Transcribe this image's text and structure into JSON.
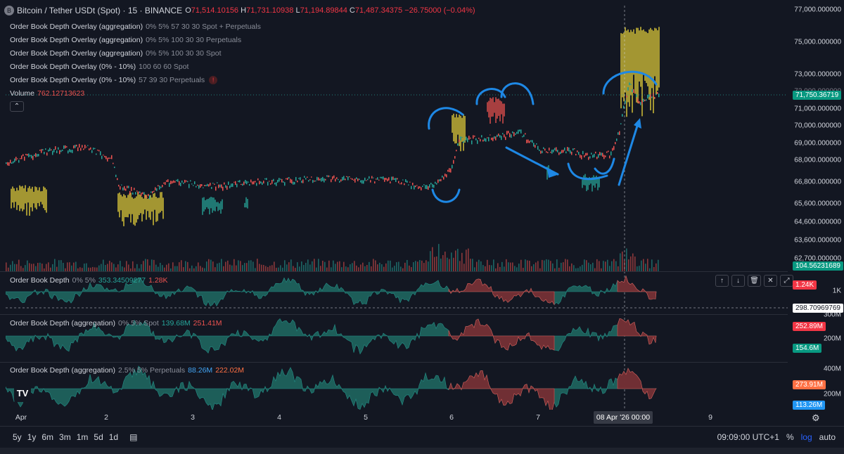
{
  "header": {
    "symbol_icon": "B",
    "symbol": "Bitcoin / Tether USDt (Spot) · 15 · BINANCE",
    "o_label": "O",
    "o": "71,514.10156",
    "h_label": "H",
    "h": "71,731.10938",
    "l_label": "L",
    "l": "71,194.89844",
    "c_label": "C",
    "c": "71,487.34375",
    "change": "−26.75000 (−0.04%)"
  },
  "legend": [
    {
      "name": "Order Book Depth Overlay (aggregation)",
      "params": "0% 5% 57 30 30 Spot + Perpetuals"
    },
    {
      "name": "Order Book Depth Overlay (aggregation)",
      "params": "0% 5% 100 30 30 Perpetuals"
    },
    {
      "name": "Order Book Depth Overlay (aggregation)",
      "params": "0% 5% 100 30 30 Spot"
    },
    {
      "name": "Order Book Depth Overlay (0% - 10%)",
      "params": "100 60 60 Spot"
    },
    {
      "name": "Order Book Depth Overlay (0% - 10%)",
      "params": "57 39 30 Perpetuals"
    }
  ],
  "volume": {
    "name": "Volume",
    "value": "762.12713623"
  },
  "price_axis": [
    "77,000.000000",
    "75,000.000000",
    "73,000.000000",
    "71,000.000000",
    "70,000.000000",
    "69,000.000000",
    "68,000.000000",
    "66,800.000000",
    "65,600.000000",
    "64,600.000000",
    "63,600.000000",
    "62,700.000000"
  ],
  "price_tags": {
    "last": "71,750.36719",
    "volume": "104.56231689",
    "obd1_red": "1.24K",
    "obd1_cross": "298.70969769",
    "obd2_red": "252.89M",
    "obd2_green": "154.6M",
    "obd3_red": "273.91M",
    "obd3_blue": "113.26M"
  },
  "price_partial": "72,000.000000",
  "pane1": {
    "name": "Order Book Depth",
    "params": "0% 5%",
    "v1": "353.34509277",
    "v2": "1.28K",
    "axis": [
      "1K",
      "300M"
    ]
  },
  "pane2": {
    "name": "Order Book Depth (aggregation)",
    "params": "0% 5% Spot",
    "v1": "139.68M",
    "v2": "251.41M",
    "axis": [
      "200M"
    ]
  },
  "pane3": {
    "name": "Order Book Depth (aggregation)",
    "params": "2.5% 5% Perpetuals",
    "v1": "88.26M",
    "v2": "222.02M",
    "axis": [
      "400M",
      "200M"
    ]
  },
  "time_axis": [
    "Apr",
    "2",
    "3",
    "4",
    "5",
    "6",
    "7",
    "9"
  ],
  "crosshair_time": "08 Apr '26   00:00",
  "ranges": [
    "5y",
    "1y",
    "6m",
    "3m",
    "1m",
    "5d",
    "1d"
  ],
  "clock": "09:09:00 UTC+1",
  "scale_percent": "%",
  "scale_log": "log",
  "scale_auto": "auto",
  "logo": "TV",
  "colors": {
    "up": "#26a69a",
    "down": "#ef5350",
    "yellow": "#e8d43a",
    "annotation": "#1e88e5",
    "bg": "#131722"
  }
}
